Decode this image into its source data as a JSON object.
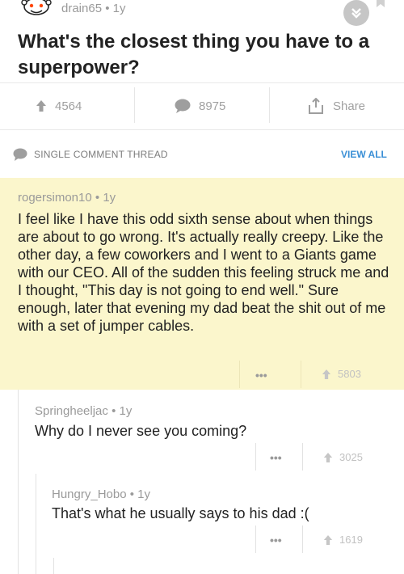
{
  "post": {
    "author": "drain65",
    "age": "1y",
    "title": "What's the closest thing you have to a superpower?",
    "upvotes": "4564",
    "comments": "8975",
    "share_label": "Share"
  },
  "thread": {
    "label": "SINGLE COMMENT THREAD",
    "view_all": "VIEW ALL"
  },
  "comments": [
    {
      "author": "rogersimon10",
      "age": "1y",
      "body": "I feel like I have this odd sixth sense about when things are about to go wrong. It's actually really creepy. Like the other day, a few coworkers and I went to a Giants game with our CEO. All of the sudden this feeling struck me and I thought, \"This day is not going to end well.\" Sure enough, later that evening my dad beat the shit out of me with a set of jumper cables.",
      "score": "5803"
    },
    {
      "author": "Springheeljac",
      "age": "1y",
      "body": "Why do I never see you coming?",
      "score": "3025"
    },
    {
      "author": "Hungry_Hobo",
      "age": "1y",
      "body": "That's what he usually says to his dad :(",
      "score": "1619"
    }
  ],
  "colors": {
    "highlight": "#fbf6cc",
    "accent": "#3a8fd6",
    "muted": "#9a9a9a"
  },
  "icons": [
    "reddit-alien-avatar-icon",
    "collapse-chevrons-icon",
    "bookmark-icon",
    "upvote-arrow-icon",
    "comment-bubble-icon",
    "share-icon",
    "more-dots-icon"
  ],
  "more_dots": "•••",
  "separator": "•"
}
